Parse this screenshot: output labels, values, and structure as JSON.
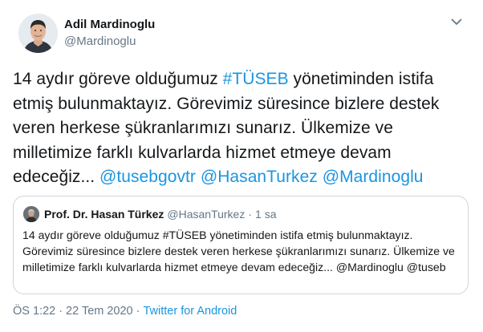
{
  "author": {
    "display_name": "Adil Mardinoglu",
    "handle": "@Mardinoglu"
  },
  "tweet": {
    "text_parts": [
      {
        "text": "14 aydır göreve olduğumuz ",
        "link": false
      },
      {
        "text": "#TÜSEB",
        "link": true
      },
      {
        "text": " yönetiminden istifa etmiş bulunmaktayız. Görevimiz süresince bizlere destek veren herkese şükranlarımızı sunarız. Ülkemize ve milletimize farklı kulvarlarda hizmet etmeye devam edeceğiz... ",
        "link": false
      },
      {
        "text": "@tusebgovtr",
        "link": true
      },
      {
        "text": " ",
        "link": false
      },
      {
        "text": "@HasanTurkez",
        "link": true
      },
      {
        "text": " ",
        "link": false
      },
      {
        "text": "@Mardinoglu",
        "link": true
      }
    ]
  },
  "quoted_tweet": {
    "display_name": "Prof. Dr. Hasan Türkez",
    "handle": "@HasanTurkez",
    "separator": "·",
    "time": "1 sa",
    "text": "14 aydır göreve olduğumuz #TÜSEB yönetiminden istifa etmiş bulunmaktayız. Görevimiz süresince bizlere destek veren herkese şükranlarımızı sunarız. Ülkemize ve milletimize farklı kulvarlarda hizmet etmeye devam edeceğiz... @Mardinoglu @tuseb"
  },
  "meta": {
    "time": "ÖS 1:22",
    "separator1": "·",
    "date": "22 Tem 2020",
    "separator2": "·",
    "source": "Twitter for Android"
  },
  "colors": {
    "link": "#1b95e0",
    "secondary_text": "#657786",
    "border": "#ccd6dd"
  },
  "icons": {
    "menu": "chevron-down-icon"
  }
}
